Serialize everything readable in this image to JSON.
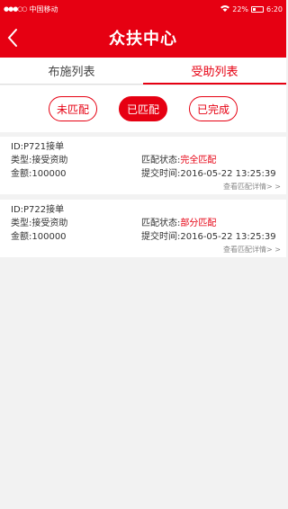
{
  "status": {
    "carrier": "中国移动",
    "battery": "22%",
    "time": "6:20"
  },
  "nav": {
    "title": "众扶中心"
  },
  "tabs": [
    {
      "label": "布施列表",
      "active": false
    },
    {
      "label": "受助列表",
      "active": true
    }
  ],
  "filters": [
    {
      "label": "未匹配",
      "selected": false
    },
    {
      "label": "已匹配",
      "selected": true
    },
    {
      "label": "已完成",
      "selected": false
    }
  ],
  "records": [
    {
      "id": "ID:P721接单",
      "type": "类型:接受资助",
      "status_label": "匹配状态:",
      "status_value": "完全匹配",
      "amount": "金额:100000",
      "submitted": "提交时间:2016-05-22  13:25:39",
      "detail_link": "查看匹配详情> >"
    },
    {
      "id": "ID:P722接单",
      "type": "类型:接受资助",
      "status_label": "匹配状态:",
      "status_value": "部分匹配",
      "amount": "金额:100000",
      "submitted": "提交时间:2016-05-22  13:25:39",
      "detail_link": "查看匹配详情> >"
    }
  ],
  "colors": {
    "brand": "#e60012",
    "background": "#f2f2f2"
  }
}
